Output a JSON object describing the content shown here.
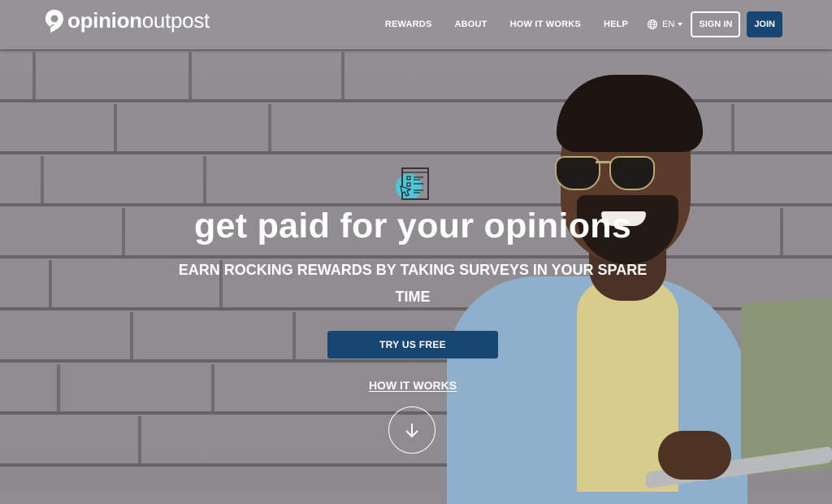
{
  "brand": {
    "name_bold": "opinion",
    "name_light": "outpost",
    "primary_color": "#184673",
    "accent_icon_color": "#4cc7d6"
  },
  "nav": {
    "links": [
      {
        "label": "REWARDS"
      },
      {
        "label": "ABOUT"
      },
      {
        "label": "HOW IT WORKS"
      },
      {
        "label": "HELP"
      }
    ],
    "language": "EN",
    "sign_in_label": "SIGN IN",
    "join_label": "JOIN"
  },
  "hero": {
    "icon": "survey-document-icon",
    "headline": "get paid for your opinions",
    "subheadline": "EARN ROCKING REWARDS BY TAKING SURVEYS IN YOUR SPARE TIME",
    "cta_label": "TRY US FREE",
    "secondary_link": "HOW IT WORKS",
    "scroll_icon": "arrow-down-icon"
  }
}
